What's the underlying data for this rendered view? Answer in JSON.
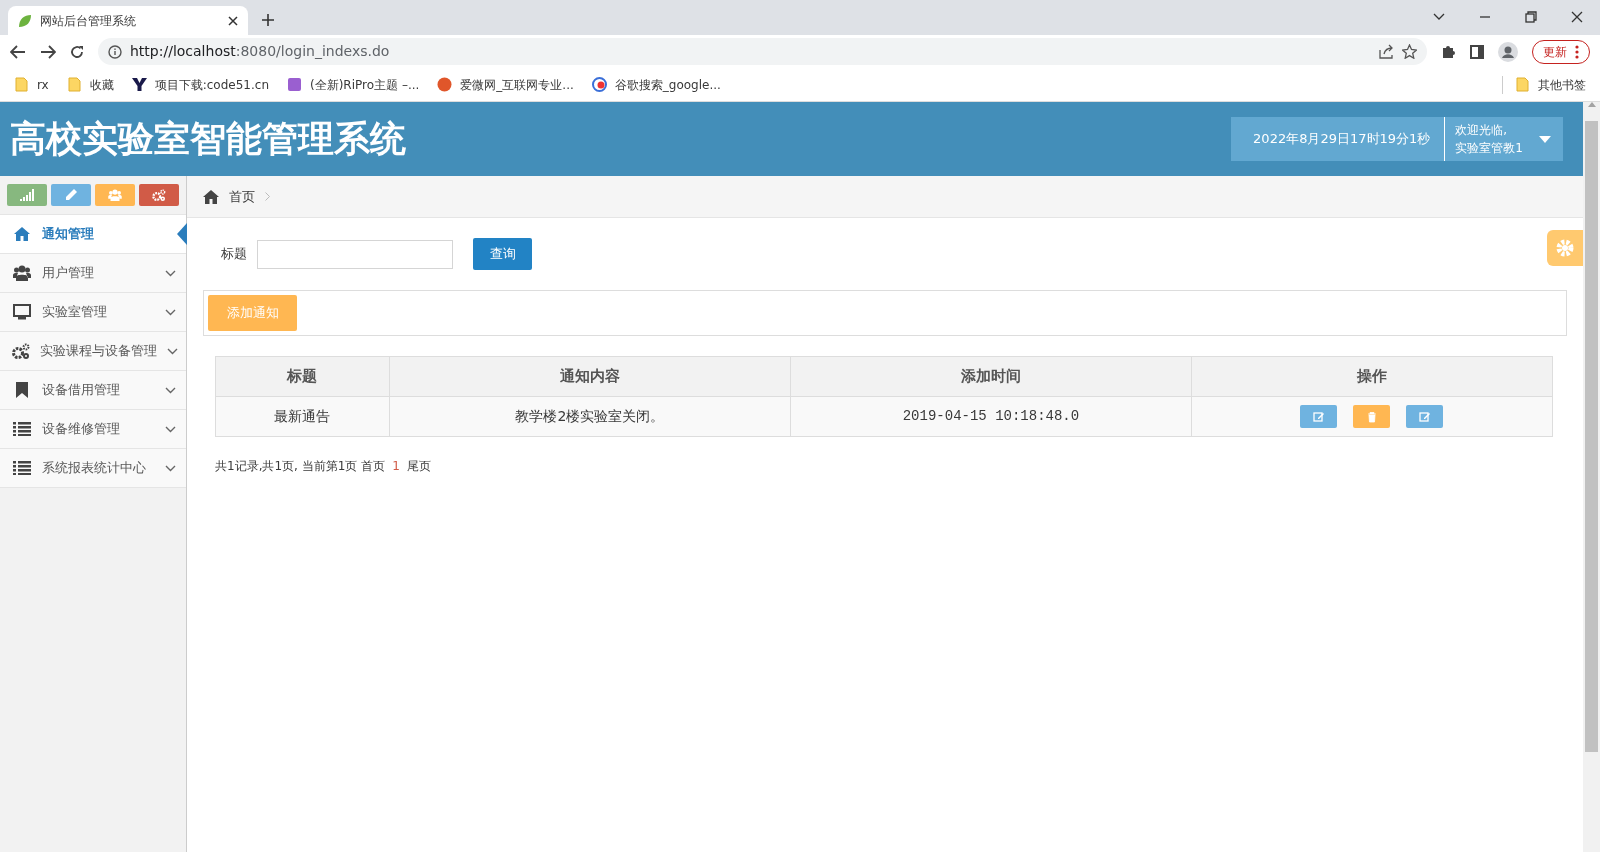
{
  "browser": {
    "tab_title": "网站后台管理系统",
    "url_host": "http://localhost",
    "url_rest": ":8080/login_indexs.do",
    "update_label": "更新",
    "bookmarks": [
      {
        "label": "rx",
        "kind": "folder"
      },
      {
        "label": "收藏",
        "kind": "folder"
      },
      {
        "label": "项目下载:code51.cn",
        "kind": "y"
      },
      {
        "label": "(全新)RiPro主题 –...",
        "kind": "zy"
      },
      {
        "label": "爱微网_互联网专业...",
        "kind": "ai"
      },
      {
        "label": "谷歌搜索_google...",
        "kind": "g"
      }
    ],
    "other_bookmarks": "其他书签"
  },
  "header": {
    "title": "高校实验室智能管理系统",
    "datetime": "2022年8月29日17时19分1秒",
    "welcome": "欢迎光临,",
    "user": "实验室管教1"
  },
  "shortcuts": [
    {
      "kind": "chart",
      "color": "#87b87f"
    },
    {
      "kind": "pencil",
      "color": "#6fb3e0"
    },
    {
      "kind": "users",
      "color": "#ffb752"
    },
    {
      "kind": "cogs",
      "color": "#d15b47"
    }
  ],
  "sidebar": {
    "items": [
      {
        "label": "通知管理",
        "kind": "home",
        "selected": true,
        "expandable": false
      },
      {
        "label": "用户管理",
        "kind": "users",
        "selected": false,
        "expandable": true
      },
      {
        "label": "实验室管理",
        "kind": "monitor",
        "selected": false,
        "expandable": true
      },
      {
        "label": "实验课程与设备管理",
        "kind": "cogs",
        "selected": false,
        "expandable": true
      },
      {
        "label": "设备借用管理",
        "kind": "bookmark",
        "selected": false,
        "expandable": true
      },
      {
        "label": "设备维修管理",
        "kind": "list",
        "selected": false,
        "expandable": true
      },
      {
        "label": "系统报表统计中心",
        "kind": "list",
        "selected": false,
        "expandable": true
      }
    ]
  },
  "breadcrumb": [
    "首页"
  ],
  "search": {
    "label": "标题",
    "button": "查询"
  },
  "add_button": "添加通知",
  "table": {
    "columns": [
      "标题",
      "通知内容",
      "添加时间",
      "操作"
    ],
    "rows": [
      {
        "cells": [
          "最新通告",
          "教学楼2楼实验室关闭。",
          "2019-04-15 10:18:48.0"
        ],
        "actions": [
          {
            "kind": "edit"
          },
          {
            "kind": "delete"
          },
          {
            "kind": "edit"
          }
        ]
      }
    ]
  },
  "pagination": {
    "info": "共1记录,共1页, 当前第1页",
    "first": "首页",
    "pages": [
      {
        "label": "1",
        "selected": true
      }
    ],
    "last": "尾页"
  }
}
